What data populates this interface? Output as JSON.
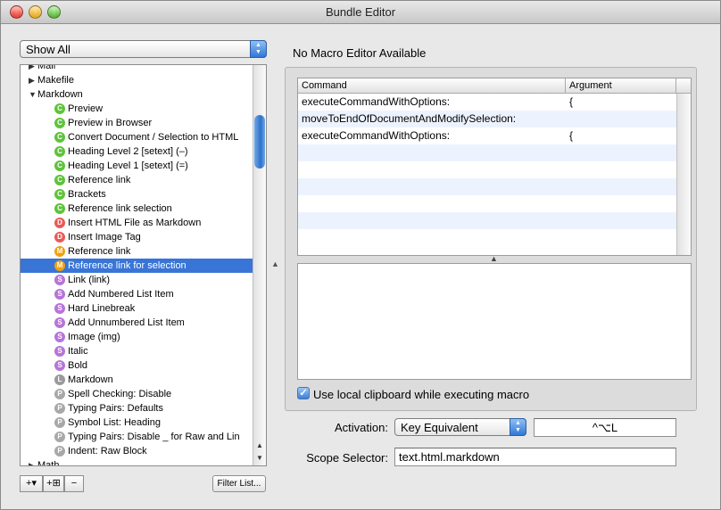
{
  "window": {
    "title": "Bundle Editor"
  },
  "filter_popup": {
    "value": "Show All"
  },
  "tree": {
    "rows": [
      {
        "kind": "bundle",
        "label": "Mail",
        "expanded": false
      },
      {
        "kind": "bundle",
        "label": "Makefile",
        "expanded": false
      },
      {
        "kind": "bundle",
        "label": "Markdown",
        "expanded": true
      },
      {
        "kind": "item",
        "badge": "C",
        "label": "Preview"
      },
      {
        "kind": "item",
        "badge": "C",
        "label": "Preview in Browser"
      },
      {
        "kind": "item",
        "badge": "C",
        "label": "Convert Document / Selection to HTML"
      },
      {
        "kind": "item",
        "badge": "C",
        "label": "Heading Level 2 [setext] (–)"
      },
      {
        "kind": "item",
        "badge": "C",
        "label": "Heading Level 1 [setext] (=)"
      },
      {
        "kind": "item",
        "badge": "C",
        "label": "Reference link"
      },
      {
        "kind": "item",
        "badge": "C",
        "label": "Brackets"
      },
      {
        "kind": "item",
        "badge": "C",
        "label": "Reference link selection"
      },
      {
        "kind": "item",
        "badge": "D",
        "label": "Insert HTML File as Markdown"
      },
      {
        "kind": "item",
        "badge": "D",
        "label": "Insert Image Tag"
      },
      {
        "kind": "item",
        "badge": "M",
        "label": "Reference link"
      },
      {
        "kind": "item",
        "badge": "M",
        "label": "Reference link for selection",
        "selected": true
      },
      {
        "kind": "item",
        "badge": "S",
        "label": "Link (link)"
      },
      {
        "kind": "item",
        "badge": "S",
        "label": "Add Numbered List Item"
      },
      {
        "kind": "item",
        "badge": "S",
        "label": "Hard Linebreak"
      },
      {
        "kind": "item",
        "badge": "S",
        "label": "Add Unnumbered List Item"
      },
      {
        "kind": "item",
        "badge": "S",
        "label": "Image (img)"
      },
      {
        "kind": "item",
        "badge": "S",
        "label": "Italic"
      },
      {
        "kind": "item",
        "badge": "S",
        "label": "Bold"
      },
      {
        "kind": "item",
        "badge": "L",
        "label": "Markdown"
      },
      {
        "kind": "item",
        "badge": "P",
        "label": "Spell Checking: Disable"
      },
      {
        "kind": "item",
        "badge": "P",
        "label": "Typing Pairs: Defaults"
      },
      {
        "kind": "item",
        "badge": "P",
        "label": "Symbol List: Heading"
      },
      {
        "kind": "item",
        "badge": "P",
        "label": "Typing Pairs: Disable _ for Raw and Lin"
      },
      {
        "kind": "item",
        "badge": "P",
        "label": "Indent: Raw Block"
      },
      {
        "kind": "bundle",
        "label": "Math",
        "expanded": false
      }
    ]
  },
  "bottom_bar": {
    "add_label": "+▾",
    "add_child_label": "+⊞",
    "remove_label": "−",
    "filter_label": "Filter List..."
  },
  "editor": {
    "header": "No Macro Editor Available",
    "columns": [
      "Command",
      "Argument"
    ],
    "rows": [
      {
        "command": "executeCommandWithOptions:",
        "argument": "{"
      },
      {
        "command": "moveToEndOfDocumentAndModifySelection:",
        "argument": ""
      },
      {
        "command": "executeCommandWithOptions:",
        "argument": "{"
      }
    ],
    "clipboard_label": "Use local clipboard while executing macro",
    "clipboard_checked": true
  },
  "activation": {
    "label": "Activation:",
    "value": "Key Equivalent",
    "key": "^⌥L"
  },
  "scope": {
    "label": "Scope Selector:",
    "value": "text.html.markdown"
  },
  "colors": {
    "selection": "#3875d7",
    "accent": "#2f78d8"
  }
}
